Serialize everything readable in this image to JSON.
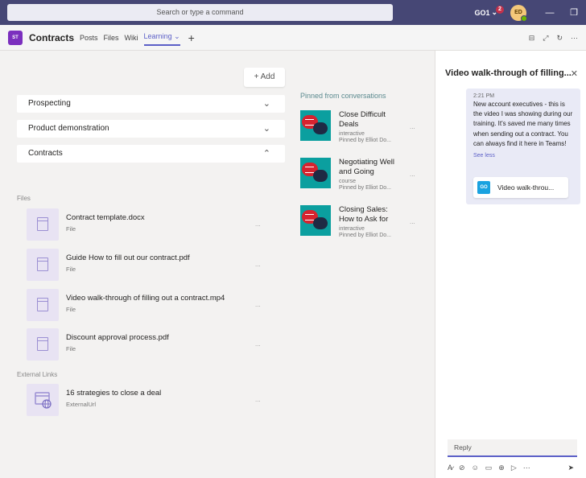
{
  "titlebar": {
    "search_placeholder": "Search or type a command",
    "org": "GO1",
    "org_chevron": "⌄",
    "notification_count": "2",
    "user_initials": "ED",
    "minimize_icon": "—",
    "restore_icon": "❐",
    "close_icon": "✕"
  },
  "header": {
    "team_initials": "ST",
    "channel_name": "Contracts",
    "tabs": [
      "Posts",
      "Files",
      "Wiki",
      "Learning ⌄"
    ],
    "add_tab": "+",
    "icons": [
      "⊟",
      "⤢",
      "↻",
      "⋯"
    ]
  },
  "learning": {
    "add_label": "+ Add",
    "sections": [
      {
        "label": "Prospecting",
        "chevron": "⌄"
      },
      {
        "label": "Product demonstration",
        "chevron": "⌄"
      },
      {
        "label": "Contracts",
        "chevron": "⌃"
      }
    ],
    "files_label": "Files",
    "files": [
      {
        "name": "Contract template.docx",
        "type": "File",
        "more": "..."
      },
      {
        "name": "Guide How to fill out our contract.pdf",
        "type": "File",
        "more": "..."
      },
      {
        "name": "Video walk-through of filling out a contract.mp4",
        "type": "File",
        "more": "..."
      },
      {
        "name": "Discount approval process.pdf",
        "type": "File",
        "more": "..."
      }
    ],
    "external_label": "External Links",
    "links": [
      {
        "name": "16 strategies to close a deal",
        "type": "ExternalUrl",
        "more": "..."
      }
    ]
  },
  "pinned": {
    "header": "Pinned from conversations",
    "items": [
      {
        "title": "Close Difficult Deals",
        "kind": "interactive",
        "by": "Pinned by Elliot Do...",
        "more": "..."
      },
      {
        "title": "Negotiating Well and Going",
        "kind": "course",
        "by": "Pinned by Elliot Do...",
        "more": "..."
      },
      {
        "title": "Closing Sales: How to Ask for",
        "kind": "interactive",
        "by": "Pinned by Elliot Do...",
        "more": "..."
      }
    ]
  },
  "panel": {
    "title": "Video walk-through of filling...",
    "close": "✕",
    "message": {
      "time": "2:21 PM",
      "text": "New account executives - this is the video I was showing during our training. It's saved me many times when sending out a contract. You can always find it here in Teams!",
      "see_less": "See less",
      "attachment_icon": "GO",
      "attachment": "Video walk-throu..."
    },
    "reply_placeholder": "Reply",
    "tools": [
      "A̷",
      "⊘",
      "☺",
      "▭",
      "⊕",
      "▷",
      "⋯"
    ],
    "send": "➤"
  }
}
